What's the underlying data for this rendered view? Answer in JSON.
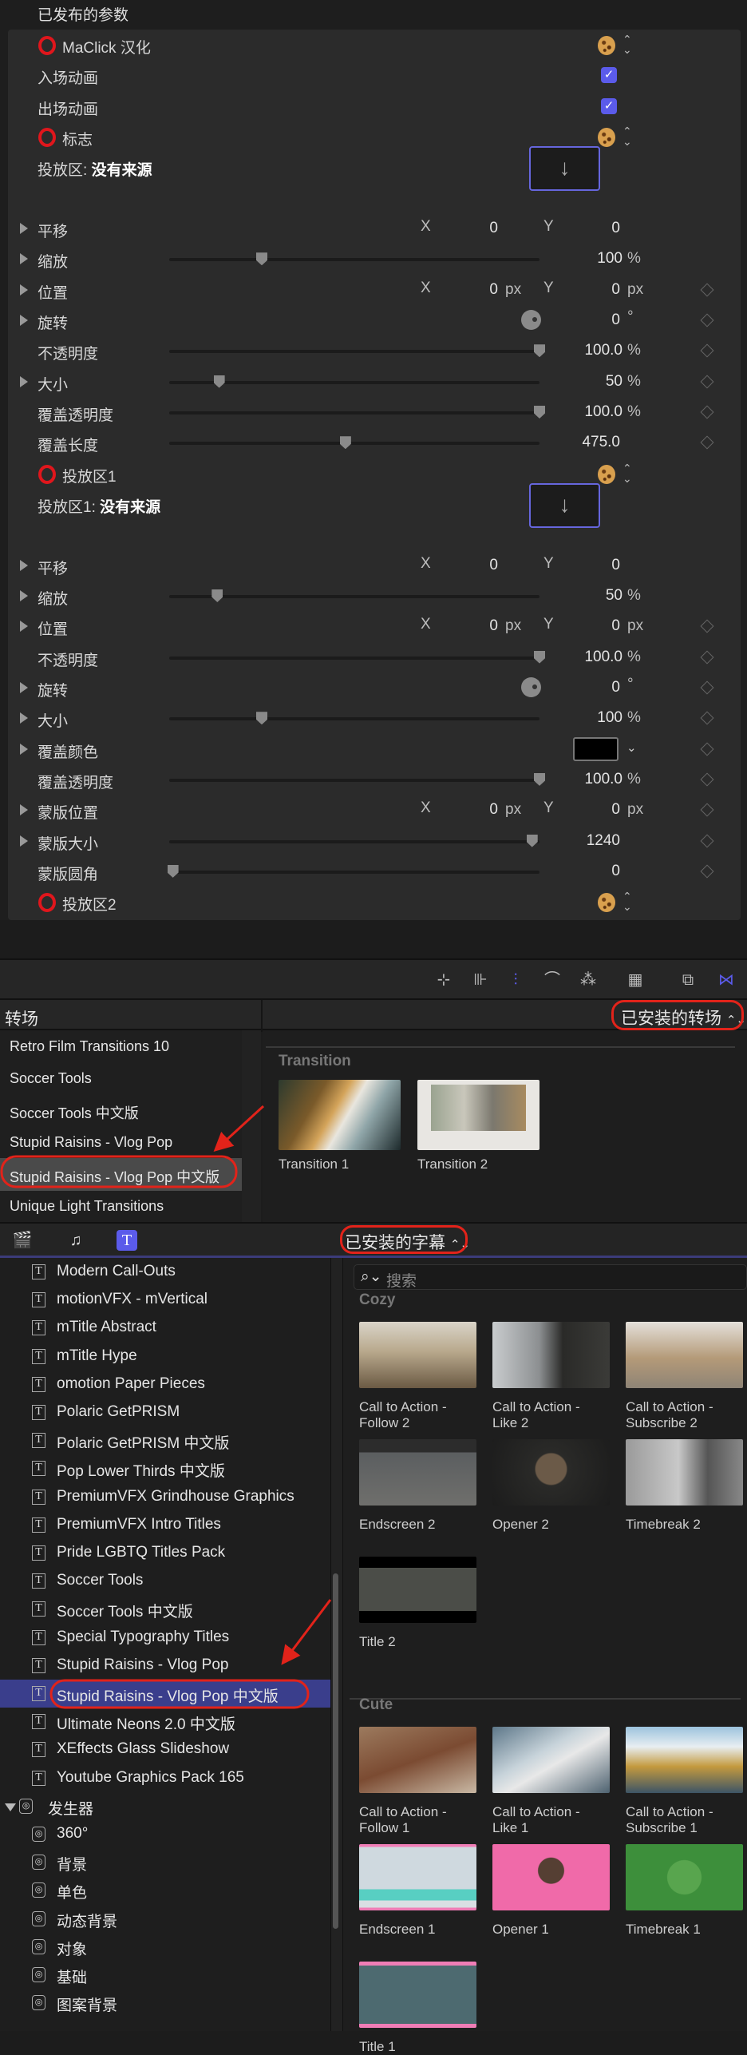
{
  "inspector": {
    "title": "已发布的参数",
    "rows": [
      {
        "label": "MaClick 汉化",
        "type": "group",
        "icon": "cookie-icon"
      },
      {
        "label": "入场动画",
        "type": "checkbox",
        "checked": true
      },
      {
        "label": "出场动画",
        "type": "checkbox",
        "checked": true
      },
      {
        "label": "标志",
        "type": "group",
        "icon": "cookie-icon"
      },
      {
        "label": "投放区:",
        "value": "没有来源",
        "type": "dropzone",
        "icon": "arrow-down-icon"
      },
      {
        "label": "平移",
        "type": "xy",
        "expand": true,
        "x": "0",
        "y": "0",
        "x_label": "X",
        "y_label": "Y"
      },
      {
        "label": "缩放",
        "type": "slider",
        "expand": true,
        "value": "100",
        "unit": "%",
        "level": 0.25
      },
      {
        "label": "位置",
        "type": "xy",
        "expand": true,
        "x": "0",
        "y": "0",
        "unit": "px",
        "x_label": "X",
        "y_label": "Y",
        "keyframe": true
      },
      {
        "label": "旋转",
        "type": "dial",
        "expand": true,
        "value": "0",
        "unit": "°",
        "keyframe": true
      },
      {
        "label": "不透明度",
        "type": "slider",
        "value": "100.0",
        "unit": "%",
        "level": 1.0,
        "keyframe": true
      },
      {
        "label": "大小",
        "type": "slider",
        "expand": true,
        "value": "50",
        "unit": "%",
        "level": 0.135,
        "keyframe": true
      },
      {
        "label": "覆盖透明度",
        "type": "slider",
        "value": "100.0",
        "unit": "%",
        "level": 1.0,
        "keyframe": true
      },
      {
        "label": "覆盖长度",
        "type": "slider",
        "value": "475.0",
        "unit": "",
        "level": 0.476,
        "keyframe": true
      },
      {
        "label": "投放区1",
        "type": "group",
        "icon": "cookie-icon"
      },
      {
        "label": "投放区1:",
        "value": "没有来源",
        "type": "dropzone",
        "icon": "arrow-down-icon"
      },
      {
        "label": "平移",
        "type": "xy",
        "expand": true,
        "x": "0",
        "y": "0",
        "x_label": "X",
        "y_label": "Y"
      },
      {
        "label": "缩放",
        "type": "slider",
        "expand": true,
        "value": "50",
        "unit": "%",
        "level": 0.13
      },
      {
        "label": "位置",
        "type": "xy",
        "expand": true,
        "x": "0",
        "y": "0",
        "unit": "px",
        "x_label": "X",
        "y_label": "Y",
        "keyframe": true
      },
      {
        "label": "不透明度",
        "type": "slider",
        "value": "100.0",
        "unit": "%",
        "level": 1.0,
        "keyframe": true
      },
      {
        "label": "旋转",
        "type": "dial",
        "expand": true,
        "value": "0",
        "unit": "°",
        "keyframe": true
      },
      {
        "label": "大小",
        "type": "slider",
        "expand": true,
        "value": "100",
        "unit": "%",
        "level": 0.25,
        "keyframe": true
      },
      {
        "label": "覆盖颜色",
        "type": "color",
        "expand": true,
        "color": "#000000",
        "keyframe": true
      },
      {
        "label": "覆盖透明度",
        "type": "slider",
        "value": "100.0",
        "unit": "%",
        "level": 1.0,
        "keyframe": true
      },
      {
        "label": "蒙版位置",
        "type": "xy",
        "expand": true,
        "x": "0",
        "y": "0",
        "unit": "px",
        "x_label": "X",
        "y_label": "Y",
        "keyframe": true
      },
      {
        "label": "蒙版大小",
        "type": "slider",
        "expand": true,
        "value": "1240",
        "unit": "",
        "level": 0.98,
        "keyframe": true
      },
      {
        "label": "蒙版圆角",
        "type": "slider",
        "value": "0",
        "unit": "",
        "level": 0.01,
        "keyframe": true
      },
      {
        "label": "投放区2",
        "type": "group",
        "icon": "cookie-icon"
      }
    ]
  },
  "toolbar": {
    "icons": [
      "skimming-icon",
      "snapping-icon",
      "audio-skimming-icon",
      "headphones-icon",
      "solo-icon",
      "clip-appearance-icon",
      "browser-toggle-icon",
      "transitions-browser-icon"
    ]
  },
  "transitions": {
    "title": "转场",
    "filter": "已安装的转场",
    "items": [
      "Retro Film Transitions 10",
      "Soccer Tools",
      "Soccer Tools 中文版",
      "Stupid Raisins - Vlog Pop",
      "Stupid Raisins - Vlog Pop 中文版",
      "Unique Light Transitions"
    ],
    "selected_index": 4,
    "section": "Transition",
    "thumbs": [
      {
        "label": "Transition 1"
      },
      {
        "label": "Transition 2"
      }
    ]
  },
  "browser_bar": {
    "icons": [
      "photos-icon",
      "audio-icon",
      "titles-icon"
    ],
    "filter": "已安装的字幕"
  },
  "titles": {
    "items": [
      "Modern Call-Outs",
      "motionVFX - mVertical",
      "mTitle Abstract",
      "mTitle Hype",
      "omotion Paper Pieces",
      "Polaric GetPRISM",
      "Polaric GetPRISM 中文版",
      "Pop Lower Thirds 中文版",
      "PremiumVFX Grindhouse Graphics",
      "PremiumVFX Intro Titles",
      "Pride LGBTQ Titles Pack",
      "Soccer Tools",
      "Soccer Tools 中文版",
      "Special Typography Titles",
      "Stupid Raisins - Vlog Pop",
      "Stupid Raisins - Vlog Pop 中文版",
      "Ultimate Neons 2.0 中文版",
      "XEffects Glass Slideshow",
      "Youtube Graphics Pack 165"
    ],
    "selected_index": 15,
    "generators_label": "发生器",
    "generators": [
      "360°",
      "背景",
      "单色",
      "动态背景",
      "对象",
      "基础",
      "图案背景"
    ]
  },
  "search": {
    "placeholder": "搜索"
  },
  "gallery": [
    {
      "section": "Cozy",
      "items": [
        {
          "label": "Call to Action - Follow 2",
          "l1": "Call to Action -",
          "l2": "Follow 2"
        },
        {
          "label": "Call to Action - Like 2",
          "l1": "Call to Action -",
          "l2": "Like 2"
        },
        {
          "label": "Call to Action - Subscribe 2",
          "l1": "Call to Action -",
          "l2": "Subscribe 2"
        },
        {
          "label": "Endscreen 2",
          "l1": "Endscreen 2",
          "l2": ""
        },
        {
          "label": "Opener 2",
          "l1": "Opener 2",
          "l2": ""
        },
        {
          "label": "Timebreak 2",
          "l1": "Timebreak 2",
          "l2": ""
        },
        {
          "label": "Title 2",
          "l1": "Title 2",
          "l2": ""
        }
      ]
    },
    {
      "section": "Cute",
      "items": [
        {
          "label": "Call to Action - Follow 1",
          "l1": "Call to Action -",
          "l2": "Follow 1"
        },
        {
          "label": "Call to Action - Like 1",
          "l1": "Call to Action -",
          "l2": "Like 1"
        },
        {
          "label": "Call to Action - Subscribe 1",
          "l1": "Call to Action -",
          "l2": "Subscribe 1"
        },
        {
          "label": "Endscreen 1",
          "l1": "Endscreen 1",
          "l2": ""
        },
        {
          "label": "Opener 1",
          "l1": "Opener 1",
          "l2": ""
        },
        {
          "label": "Timebreak 1",
          "l1": "Timebreak 1",
          "l2": ""
        },
        {
          "label": "Title 1",
          "l1": "Title 1",
          "l2": ""
        }
      ]
    }
  ],
  "colors": {
    "accent": "#5b5bea",
    "annotation": "#e2231a",
    "selection": "#3a3e8c"
  }
}
